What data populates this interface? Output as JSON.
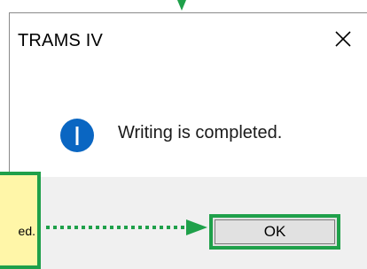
{
  "dialog": {
    "title": "TRAMS IV",
    "message": "Writing is completed.",
    "ok_label": "OK"
  },
  "annotation": {
    "callout_text": "ed."
  },
  "icons": {
    "close": "close-icon",
    "info": "info-icon"
  },
  "colors": {
    "annotation_green": "#1fa04a",
    "callout_fill": "#fff6a8",
    "info_blue": "#0a66c2",
    "footer_bg": "#f0f0f0"
  }
}
